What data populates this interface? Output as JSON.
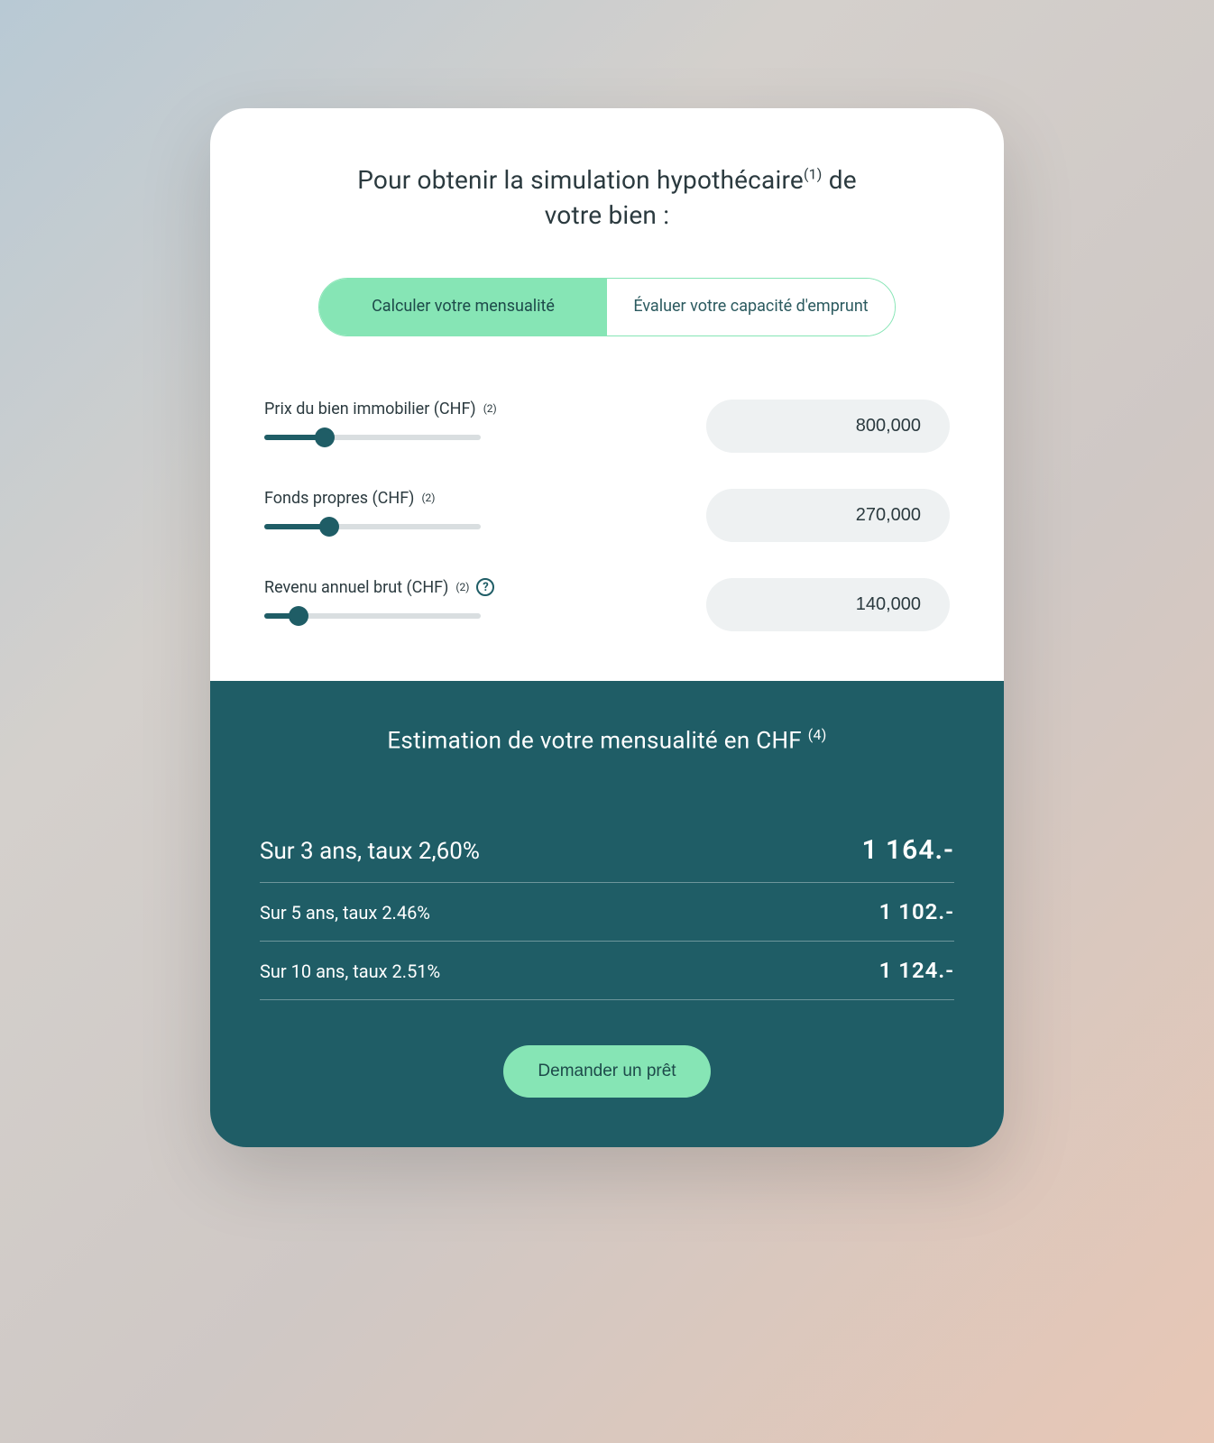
{
  "header": {
    "title_before_sup": "Pour obtenir la simulation hypothécaire",
    "title_sup": "(1)",
    "title_after_sup": " de votre bien :"
  },
  "tabs": {
    "calculate": "Calculer votre mensualité",
    "evaluate": "Évaluer votre capacité d'emprunt"
  },
  "fields": {
    "price": {
      "label_text": "Prix du bien immobilier (CHF)",
      "label_sup": "(2)",
      "value": "800,000",
      "slider_percent": 28
    },
    "equity": {
      "label_text": "Fonds propres (CHF)",
      "label_sup": "(2)",
      "value": "270,000",
      "slider_percent": 30
    },
    "income": {
      "label_text": "Revenu annuel brut (CHF)",
      "label_sup": "(2)",
      "value": "140,000",
      "slider_percent": 16,
      "has_help": true
    }
  },
  "results": {
    "title_text": "Estimation de votre mensualité en CHF",
    "title_sup": "(4)",
    "rows": [
      {
        "term": "Sur 3 ans, taux 2,60%",
        "amount": "1 164.-",
        "primary": true
      },
      {
        "term": "Sur 5 ans, taux 2.46%",
        "amount": "1 102.-",
        "primary": false
      },
      {
        "term": "Sur 10 ans, taux 2.51%",
        "amount": "1 124.-",
        "primary": false
      }
    ],
    "cta": "Demander un prêt"
  },
  "icons": {
    "help_glyph": "?"
  }
}
